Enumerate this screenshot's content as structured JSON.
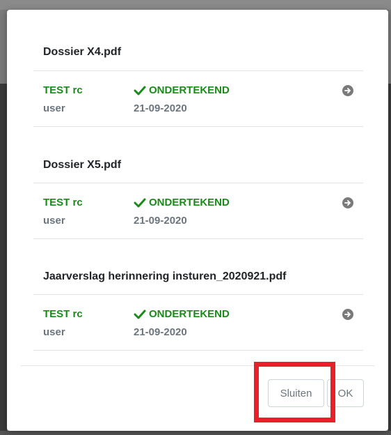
{
  "documents": [
    {
      "title": "Dossier X4.pdf",
      "signer": {
        "name": "TEST rc",
        "role": "user",
        "status": "ONDERTEKEND",
        "date": "21-09-2020"
      }
    },
    {
      "title": "Dossier X5.pdf",
      "signer": {
        "name": "TEST rc",
        "role": "user",
        "status": "ONDERTEKEND",
        "date": "21-09-2020"
      }
    },
    {
      "title": "Jaarverslag herinnering insturen_2020921.pdf",
      "signer": {
        "name": "TEST rc",
        "role": "user",
        "status": "ONDERTEKEND",
        "date": "21-09-2020"
      }
    }
  ],
  "footer": {
    "close_label": "Sluiten",
    "ok_label": "OK"
  },
  "colors": {
    "signed_green": "#1a8a1a",
    "muted_gray": "#6c757d",
    "highlight_red": "#e8202a"
  },
  "icons": {
    "status": "check-icon",
    "row_action": "arrow-right-circle-icon"
  }
}
